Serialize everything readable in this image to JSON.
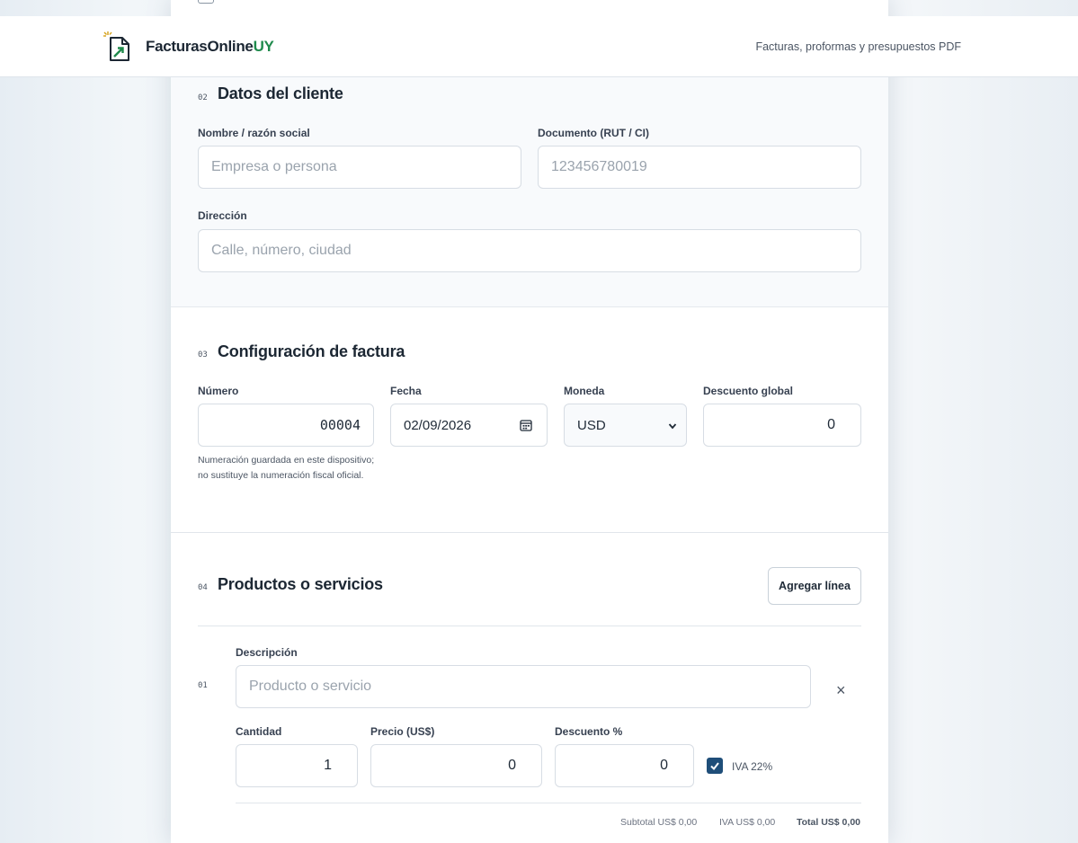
{
  "header": {
    "brand_main": "FacturasOnline",
    "brand_suffix": "UY",
    "tagline": "Facturas, proformas y presupuestos PDF",
    "logo_icon": "document-arrow-icon"
  },
  "client": {
    "number": "02",
    "title": "Datos del cliente",
    "name_label": "Nombre / razón social",
    "name_placeholder": "Empresa o persona",
    "doc_label": "Documento (RUT / CI)",
    "doc_placeholder": "123456780019",
    "address_label": "Dirección",
    "address_placeholder": "Calle, número, ciudad"
  },
  "invoice": {
    "number": "03",
    "title": "Configuración de factura",
    "num_label": "Número",
    "num_value": "00004",
    "num_hint": "Numeración guardada en este dispositivo; no sustituye la numeración fiscal oficial.",
    "date_label": "Fecha",
    "date_value": "02/09/2026",
    "currency_label": "Moneda",
    "currency_value": "USD",
    "discount_label": "Descuento global",
    "discount_value": "0"
  },
  "products": {
    "number": "04",
    "title": "Productos o servicios",
    "add_button": "Agregar línea",
    "line": {
      "index": "01",
      "desc_label": "Descripción",
      "desc_placeholder": "Producto o servicio",
      "qty_label": "Cantidad",
      "qty_value": "1",
      "price_label": "Precio (US$)",
      "price_value": "0",
      "disc_label": "Descuento %",
      "disc_value": "0",
      "iva_label": "IVA 22%",
      "iva_checked": true,
      "subtotal": "Subtotal US$ 0,00",
      "iva_amount": "IVA US$ 0,00",
      "total": "Total US$ 0,00",
      "remove_symbol": "×"
    }
  },
  "colors": {
    "brand_green": "#1f8a4c",
    "checkbox_blue": "#1f4e79"
  }
}
